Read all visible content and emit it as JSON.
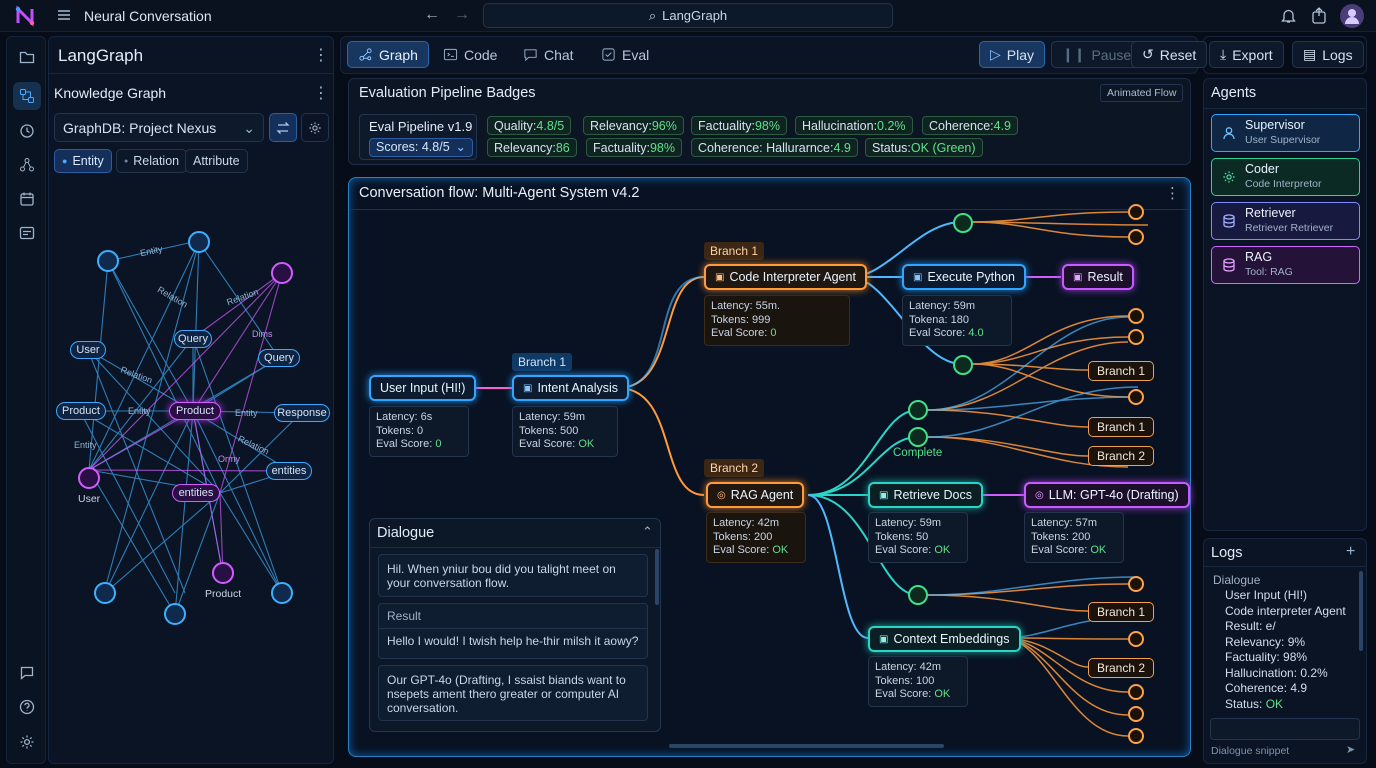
{
  "app": {
    "title": "Neural Conversation",
    "search": "LangGraph"
  },
  "left": {
    "title": "LangGraph",
    "section": "Knowledge Graph",
    "db_select": "GraphDB: Project Nexus",
    "chips": [
      "Entity",
      "Relation",
      "Attribute"
    ],
    "graph_labels": [
      "Entity",
      "Relation",
      "Relation",
      "Query",
      "Query",
      "User",
      "Product",
      "Product",
      "Response",
      "Entity",
      "Entity",
      "Entity",
      "Relation",
      "entities",
      "entities",
      "User",
      "Product",
      "Dims",
      "Relation",
      "Ormy"
    ]
  },
  "toolbar": {
    "tabs": [
      "Graph",
      "Code",
      "Chat",
      "Eval"
    ],
    "buttons": [
      "Play",
      "Pause",
      "Reset",
      "Export",
      "Logs"
    ]
  },
  "eval": {
    "title": "Evaluation Pipeline Badges",
    "tag": "Animated Flow",
    "pipeline": "Eval Pipeline v1.9",
    "scores": "Scores: 4.8/5",
    "row1": [
      {
        "k": "Quality: ",
        "v": "4.8/5"
      },
      {
        "k": "Relevancy: ",
        "v": "96%"
      },
      {
        "k": "Factuality: ",
        "v": "98%"
      },
      {
        "k": "Hallucination: ",
        "v": "0.2%"
      },
      {
        "k": "Coherence: ",
        "v": "4.9"
      }
    ],
    "row2": [
      {
        "k": "Relevancy: ",
        "v": "86"
      },
      {
        "k": "Factuality: ",
        "v": "98%"
      },
      {
        "k": "Coherence: Hallurarnce: ",
        "v": "4.9"
      },
      {
        "k": "Status: ",
        "v": "OK (Green)"
      }
    ]
  },
  "flow": {
    "title": "Conversation flow: Multi-Agent System v4.2",
    "nodes": {
      "user_input": "User Input (HI!)",
      "intent": "Intent Analysis",
      "code_agent": "Code Interpreter Agent",
      "exec_python": "Execute Python",
      "result": "Result",
      "rag": "RAG Agent",
      "retrieve": "Retrieve Docs",
      "llm": "LLM: GPT-4o (Drafting)",
      "context": "Context Embeddings"
    },
    "branch_labels": {
      "b1_top": "Branch 1",
      "b1_intent": "Branch 1",
      "b2_rag": "Branch 2"
    },
    "complete": "Complete",
    "branch_nodes": [
      "Branch 1",
      "Branch 1",
      "Branch 2",
      "Branch 1",
      "Branch 2"
    ],
    "stats": {
      "user_input": {
        "l": "Latency: 6s",
        "t": "Tokens: 0",
        "ek": "Eval Score: ",
        "ev": "0"
      },
      "intent": {
        "l": "Latency: 59m",
        "t": "Tokens: 500",
        "ek": "Eval Score: ",
        "ev": "OK"
      },
      "code_agent": {
        "l": "Latency: 55m.",
        "t": "Tokens: 999",
        "ek": "Eval Score: ",
        "ev": "0"
      },
      "exec_python": {
        "l": "Latency: 59m",
        "t": "Tokena: 180",
        "ek": "Eval Score: ",
        "ev": "4.0"
      },
      "rag": {
        "l": "Latency: 42m",
        "t": "Tokens: 200",
        "ek": "Eval Score: ",
        "ev": "OK"
      },
      "retrieve": {
        "l": "Latency: 59m",
        "t": "Tokens: 50",
        "ek": "Eval Score: ",
        "ev": "OK"
      },
      "llm": {
        "l": "Latency: 57m",
        "t": "Tokens: 200",
        "ek": "Eval Score: ",
        "ev": "OK"
      },
      "context": {
        "l": "Latency: 42m",
        "t": "Tokens: 100",
        "ek": "Eval Score: ",
        "ev": "OK"
      }
    }
  },
  "dialogue": {
    "title": "Dialogue",
    "m1": "Hil. When yniur bou did you talight meet on your conversation flow.",
    "result_label": "Result",
    "m2": "Hello I would! I twish help he-thir milsh it aowy?",
    "m3": "Our GPT-4o (Drafting, I ssaist biands want to nsepets ament thero greater or computer AI conversation."
  },
  "agents": {
    "title": "Agents",
    "list": [
      {
        "name": "Supervisor",
        "sub": "User Supervisor",
        "color": "#2fa6ff"
      },
      {
        "name": "Coder",
        "sub": "Code Interpretor",
        "color": "#2fd39a"
      },
      {
        "name": "Retriever",
        "sub": "Retriever Retriever",
        "color": "#7f8cff"
      },
      {
        "name": "RAG",
        "sub": "Tool: RAG",
        "color": "#d066ff"
      }
    ]
  },
  "logs": {
    "title": "Logs",
    "header": "Dialogue",
    "lines": [
      "User Input (HI!)",
      "Code interpreter Agent",
      "Result: e/",
      "Relevancy: 9%",
      "Factuality: 98%",
      "Hallucination: 0.2%",
      "Coherence: 4.9"
    ],
    "status_k": "Status: ",
    "status_v": "OK",
    "placeholder": "Dialogue snippet"
  }
}
